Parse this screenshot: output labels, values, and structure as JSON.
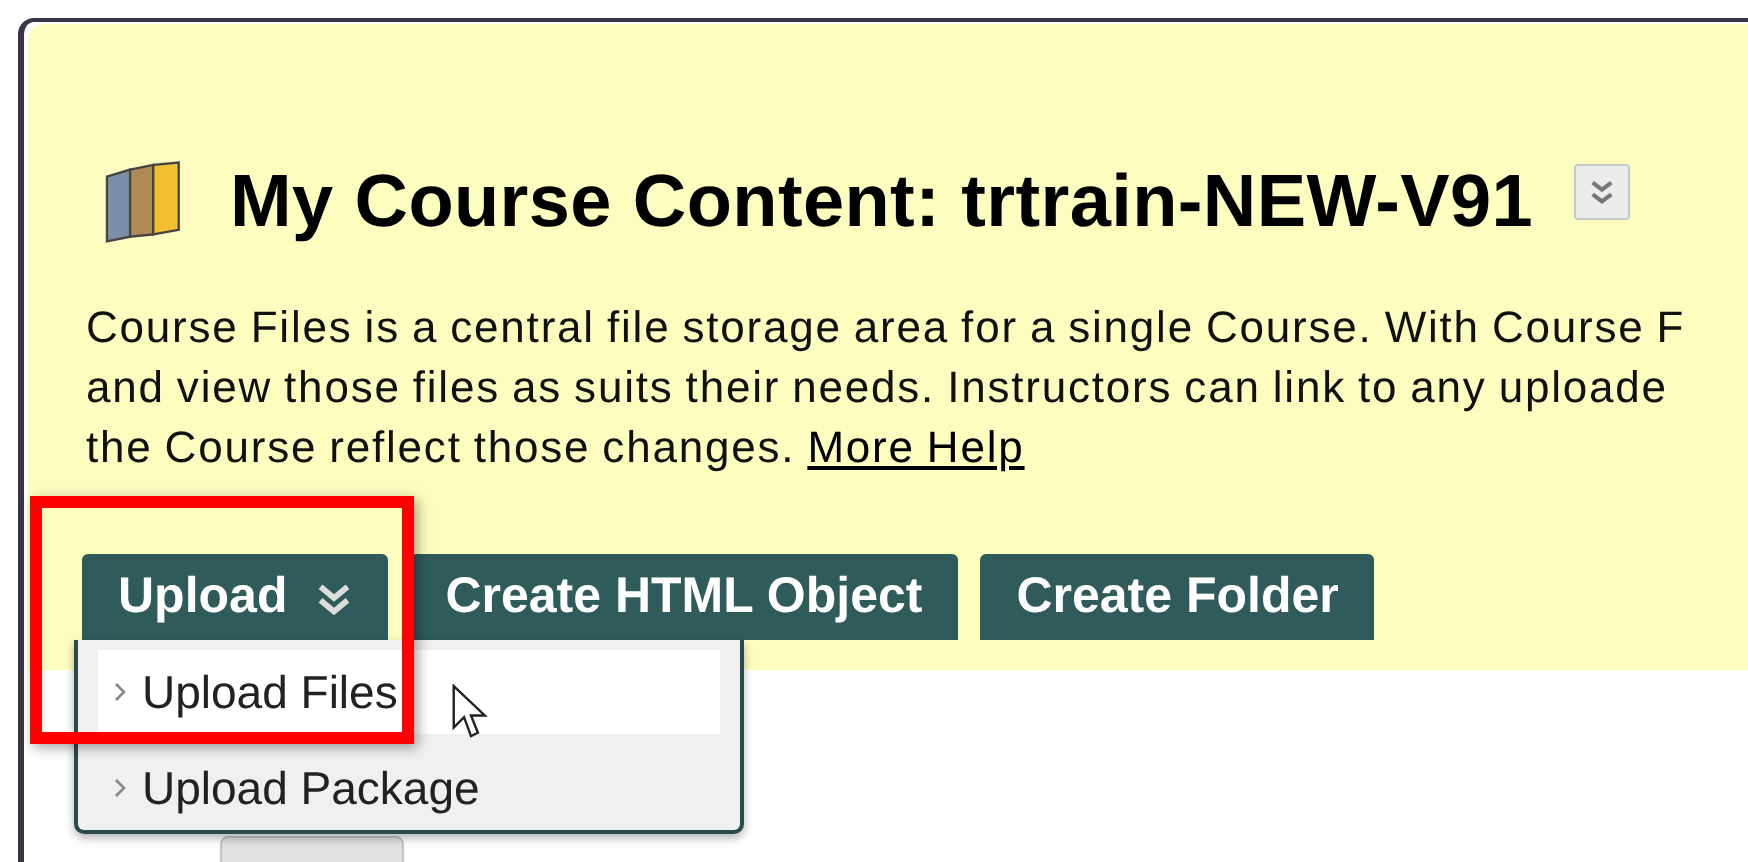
{
  "header": {
    "title": "My Course Content: trtrain-NEW-V91",
    "description": {
      "lines": [
        "Course Files is a central file storage area for a single Course. With Course F",
        "and view those files as suits their needs. Instructors can link to any uploade",
        "the Course reflect those changes."
      ],
      "link": "More Help"
    }
  },
  "toolbar": [
    {
      "label": "Upload",
      "kind": "menu",
      "expanded": true
    },
    {
      "label": "Create HTML Object",
      "kind": "action"
    },
    {
      "label": "Create Folder",
      "kind": "action"
    }
  ],
  "menu": [
    {
      "label": "Upload Files",
      "selected": true
    },
    {
      "label": "Upload Package",
      "selected": false
    }
  ]
}
